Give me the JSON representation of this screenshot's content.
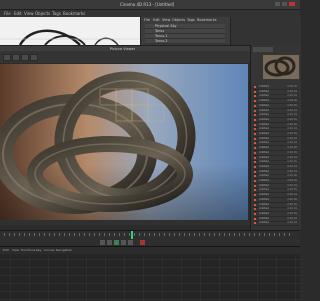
{
  "window": {
    "title": "Cinema 4D R13 - [Untitled]"
  },
  "menu": {
    "items": [
      "File",
      "Edit",
      "View",
      "Objects",
      "Tags",
      "Bookmarks"
    ]
  },
  "viewer": {
    "title": "Picture Viewer"
  },
  "object_manager": {
    "tabs": [
      "File",
      "Edit",
      "View",
      "Objects",
      "Tags",
      "Bookmarks"
    ],
    "rows": [
      "Physical Sky",
      "Torus",
      "Torus.1",
      "Torus.2"
    ]
  },
  "history": {
    "rows": [
      {
        "label": "Untitled",
        "value": "0:00:35"
      },
      {
        "label": "Untitled",
        "value": "0:00:34"
      },
      {
        "label": "Untitled",
        "value": "0:00:34"
      },
      {
        "label": "Untitled",
        "value": "0:00:36"
      },
      {
        "label": "Untitled",
        "value": "0:00:35"
      },
      {
        "label": "Untitled",
        "value": "0:00:33"
      },
      {
        "label": "Untitled",
        "value": "0:00:34"
      },
      {
        "label": "Untitled",
        "value": "0:00:35"
      },
      {
        "label": "Untitled",
        "value": "0:00:36"
      },
      {
        "label": "Untitled",
        "value": "0:00:34"
      },
      {
        "label": "Untitled",
        "value": "0:00:35"
      },
      {
        "label": "Untitled",
        "value": "0:00:33"
      },
      {
        "label": "Untitled",
        "value": "0:00:34"
      },
      {
        "label": "Untitled",
        "value": "0:00:36"
      },
      {
        "label": "Untitled",
        "value": "0:00:35"
      },
      {
        "label": "Untitled",
        "value": "0:00:34"
      },
      {
        "label": "Untitled",
        "value": "0:00:35"
      },
      {
        "label": "Untitled",
        "value": "0:00:34"
      },
      {
        "label": "Untitled",
        "value": "0:00:33"
      },
      {
        "label": "Untitled",
        "value": "0:00:36"
      },
      {
        "label": "Untitled",
        "value": "0:00:35"
      },
      {
        "label": "Untitled",
        "value": "0:00:34"
      },
      {
        "label": "Untitled",
        "value": "0:00:35"
      },
      {
        "label": "Untitled",
        "value": "0:00:34"
      },
      {
        "label": "Untitled",
        "value": "0:00:36"
      },
      {
        "label": "Untitled",
        "value": "0:00:35"
      },
      {
        "label": "Untitled",
        "value": "0:00:34"
      },
      {
        "label": "Untitled",
        "value": "0:00:35"
      },
      {
        "label": "Untitled",
        "value": "0:00:33"
      },
      {
        "label": "Untitled",
        "value": "0:00:34"
      }
    ]
  },
  "graph_toolbar": {
    "items": [
      "Edit",
      "View",
      "Functions",
      "Key",
      "Curves",
      "Navigation"
    ]
  },
  "colors": {
    "accent": "#3bd06a",
    "record": "#d45a3a",
    "panel": "#353535"
  }
}
